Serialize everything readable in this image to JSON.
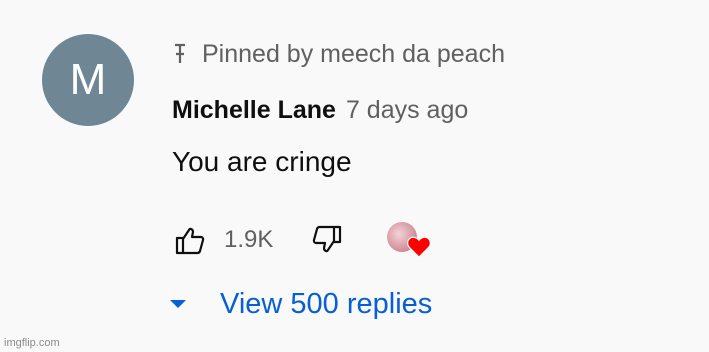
{
  "comment": {
    "avatar_letter": "M",
    "pinned_text": "Pinned by meech da peach",
    "author": "Michelle Lane",
    "timestamp": "7 days ago",
    "body": "You are cringe",
    "like_count": "1.9K",
    "replies_label": "View 500 replies"
  },
  "icons": {
    "pin": "pin-icon",
    "like": "thumbs-up-icon",
    "dislike": "thumbs-down-icon",
    "heart": "heart-icon",
    "caret": "caret-down-icon"
  },
  "colors": {
    "background": "#f9f9f9",
    "avatar_bg": "#6f8794",
    "link_blue": "#065fd4",
    "secondary_text": "#606060",
    "heart_red": "#ff0000"
  },
  "watermark": "imgflip.com"
}
